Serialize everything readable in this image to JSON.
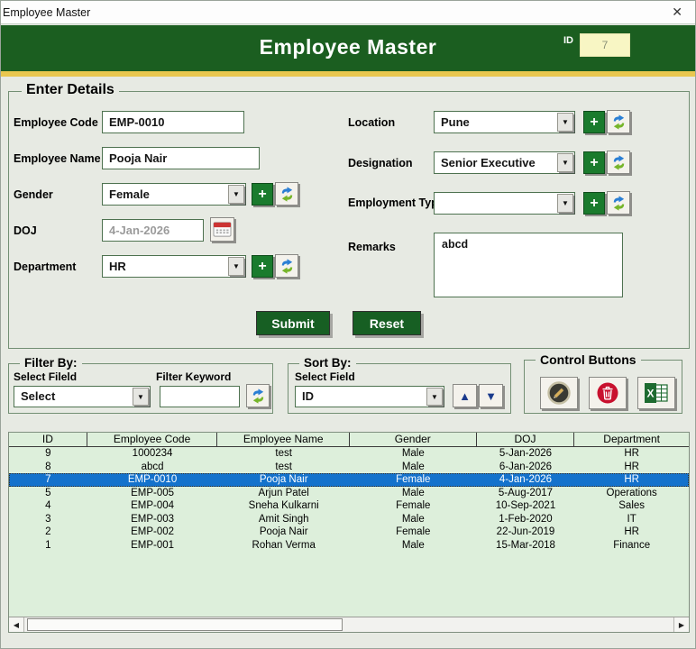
{
  "window": {
    "title": "Employee Master"
  },
  "icons": {
    "close": "✕",
    "plus": "+",
    "dropdown": "▼",
    "sort_up": "▲",
    "sort_down": "▼",
    "scroll_left": "◀",
    "scroll_right": "▶"
  },
  "colors": {
    "header_green": "#1b5e20",
    "accent_gold": "#e9c74f",
    "button_green": "#1a7b2d",
    "selected_row_blue": "#1472cc",
    "table_mint": "#ddefdb",
    "id_box_yellow": "#f8f6c4",
    "delete_red": "#c8102e",
    "excel_green": "#1e6b30",
    "sort_arrow_navy": "#1a3a8c"
  },
  "header": {
    "title": "Employee Master",
    "id_label": "ID",
    "id_value": "7"
  },
  "enter_details": {
    "caption": "Enter Details",
    "fields": {
      "employee_code": {
        "label": "Employee Code",
        "value": "EMP-0010"
      },
      "employee_name": {
        "label": "Employee Name",
        "value": "Pooja Nair"
      },
      "gender": {
        "label": "Gender",
        "value": "Female"
      },
      "doj": {
        "label": "DOJ",
        "value": "4-Jan-2026"
      },
      "department": {
        "label": "Department",
        "value": "HR"
      },
      "location": {
        "label": "Location",
        "value": "Pune"
      },
      "designation": {
        "label": "Designation",
        "value": "Senior Executive"
      },
      "employment_type": {
        "label": "Employment Type",
        "value": ""
      },
      "remarks": {
        "label": "Remarks",
        "value": "abcd"
      }
    },
    "buttons": {
      "submit": "Submit",
      "reset": "Reset"
    }
  },
  "filter_by": {
    "caption": "Filter By:",
    "select_field_label": "Select Fileld",
    "filter_keyword_label": "Filter Keyword",
    "field_value": "Select",
    "keyword_value": ""
  },
  "sort_by": {
    "caption": "Sort By:",
    "select_field_label": "Select Field",
    "field_value": "ID"
  },
  "control_buttons": {
    "caption": "Control Buttons"
  },
  "table": {
    "columns": [
      "ID",
      "Employee Code",
      "Employee Name",
      "Gender",
      "DOJ",
      "Department"
    ],
    "rows": [
      [
        "9",
        "1000234",
        "test",
        "Male",
        "5-Jan-2026",
        "HR"
      ],
      [
        "8",
        "abcd",
        "test",
        "Male",
        "6-Jan-2026",
        "HR"
      ],
      [
        "7",
        "EMP-0010",
        "Pooja Nair",
        "Female",
        "4-Jan-2026",
        "HR"
      ],
      [
        "5",
        "EMP-005",
        "Arjun Patel",
        "Male",
        "5-Aug-2017",
        "Operations"
      ],
      [
        "4",
        "EMP-004",
        "Sneha Kulkarni",
        "Female",
        "10-Sep-2021",
        "Sales"
      ],
      [
        "3",
        "EMP-003",
        "Amit Singh",
        "Male",
        "1-Feb-2020",
        "IT"
      ],
      [
        "2",
        "EMP-002",
        "Pooja Nair",
        "Female",
        "22-Jun-2019",
        "HR"
      ],
      [
        "1",
        "EMP-001",
        "Rohan Verma",
        "Male",
        "15-Mar-2018",
        "Finance"
      ]
    ],
    "selected_row_index": 2
  }
}
